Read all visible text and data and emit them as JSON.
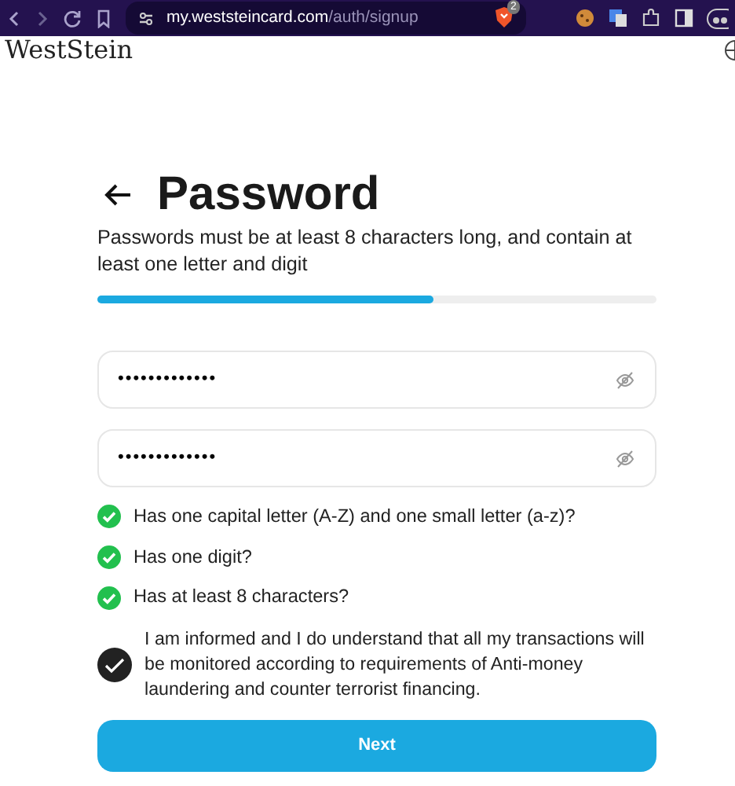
{
  "browser": {
    "url_host": "my.weststeincard.com",
    "url_path": "/auth/signup",
    "shield_badge": "2"
  },
  "brand": "WestStein",
  "title": "Password",
  "description": "Passwords must be at least 8 characters long, and contain at least one letter and digit",
  "progress": {
    "level": 0.6
  },
  "fields": [
    {
      "value": "•••••••••••••",
      "masked": true
    },
    {
      "value": "•••••••••••••",
      "masked": true
    }
  ],
  "requirements": [
    {
      "text": "Has one capital letter (A-Z) and one small letter (a-z)?",
      "met": true
    },
    {
      "text": "Has one digit?",
      "met": true
    },
    {
      "text": "Has at least 8 characters?",
      "met": true
    }
  ],
  "consent": {
    "text": "I am informed and I do understand that all my transactions will be monitored according to requirements of Anti-money laundering and counter terrorist financing.",
    "checked": true
  },
  "next_button": "Next"
}
